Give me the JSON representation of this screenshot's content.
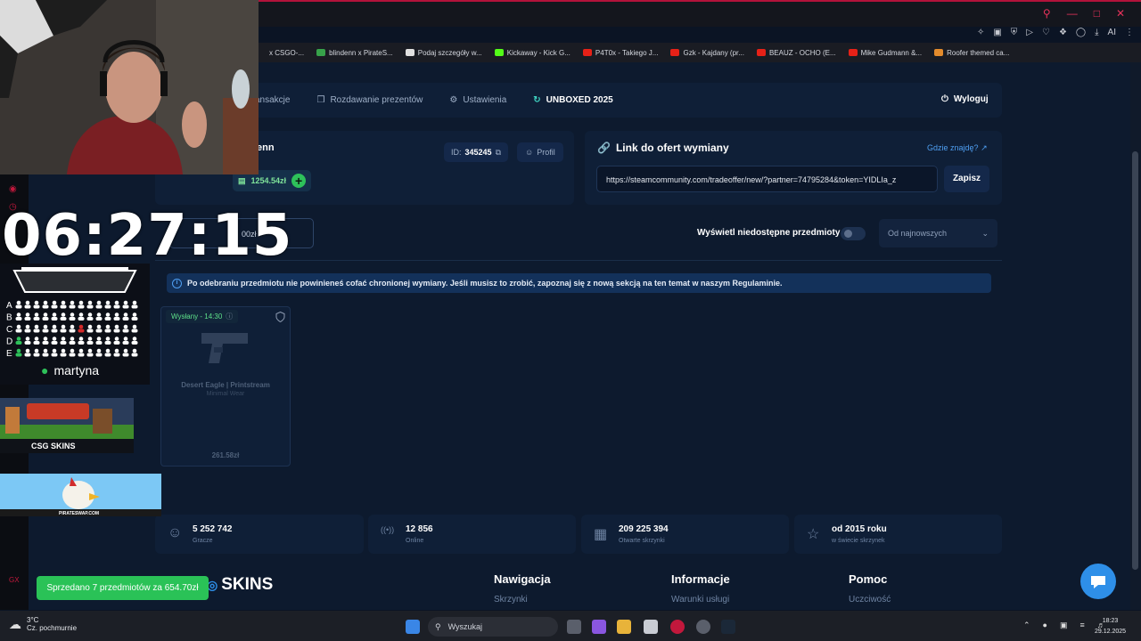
{
  "bookmarks": [
    {
      "label": "x CSGO-...",
      "color": "#1a1c23"
    },
    {
      "label": "blindenn x PirateS...",
      "color": "#37a24a"
    },
    {
      "label": "Podaj szczegóły w...",
      "color": "#e0e0e0"
    },
    {
      "label": "Kickaway - Kick G...",
      "color": "#53fc18"
    },
    {
      "label": "P4T0x - Takiego J...",
      "color": "#e62117"
    },
    {
      "label": "Gzk - Kajdany (pr...",
      "color": "#e62117"
    },
    {
      "label": "BEAUZ - OCHO (E...",
      "color": "#e62117"
    },
    {
      "label": "Mike Gudmann &...",
      "color": "#e62117"
    },
    {
      "label": "Roofer themed ca...",
      "color": "#e38b2c"
    }
  ],
  "toolbar_ai": "AI",
  "nav": {
    "items": [
      {
        "label": "ansakcje",
        "icon": "receipt-icon"
      },
      {
        "label": "Rozdawanie prezentów",
        "icon": "gift-icon"
      },
      {
        "label": "Ustawienia",
        "icon": "gear-icon"
      },
      {
        "label": "UNBOXED 2025",
        "icon": "history-icon"
      }
    ],
    "logout": "Wyloguj"
  },
  "profile": {
    "username": "enn",
    "id_label": "ID:",
    "id_value": "345245",
    "profil_btn": "Profil",
    "balance": "1254.54zł"
  },
  "trade": {
    "title": "Link do ofert wymiany",
    "help": "Gdzie znajdę?",
    "url": "https://steamcommunity.com/tradeoffer/new/?partner=74795284&token=YIDLIa_z",
    "save": "Zapisz"
  },
  "filters": {
    "sell_btn": "00zł",
    "unavailable_label": "Wyświetl niedostępne przedmioty",
    "sort_value": "Od najnowszych"
  },
  "notice": "Po odebraniu przedmiotu nie powinieneś cofać chronionej wymiany. Jeśli musisz to zrobić, zapoznaj się z nową sekcją na ten temat w naszym Regulaminie.",
  "item": {
    "status": "Wysłany - 14:30",
    "name": "Desert Eagle | Printstream",
    "sub": "Minimal Wear",
    "price": "261.58zł"
  },
  "stats": [
    {
      "value": "5 252 742",
      "label": "Gracze",
      "icon": "users-icon"
    },
    {
      "value": "12 856",
      "label": "Online",
      "icon": "broadcast-icon"
    },
    {
      "value": "209 225 394",
      "label": "Otwarte skrzynki",
      "icon": "box-icon"
    },
    {
      "value": "od 2015 roku",
      "label": "w świecie skrzynek",
      "icon": "star-icon"
    }
  ],
  "footer": {
    "logo": "SKINS",
    "cols": [
      {
        "title": "Nawigacja",
        "link": "Skrzynki"
      },
      {
        "title": "Informacje",
        "link": "Warunki usługi"
      },
      {
        "title": "Pomoc",
        "link": "Uczciwość"
      }
    ]
  },
  "overlay": {
    "timer": "06:27:15",
    "viewer": "martyna",
    "rows": [
      "A",
      "B",
      "C",
      "D",
      "E"
    ],
    "promo": "CSG SKINS",
    "pirate": "PIRATESWAP.COM",
    "toast": "Sprzedano 7 przedmiotów za 654.70zł"
  },
  "taskbar": {
    "temp": "3°C",
    "weather": "Cz. pochmurnie",
    "search": "Wyszukaj",
    "time": "18:23",
    "date": "29.12.2025"
  }
}
